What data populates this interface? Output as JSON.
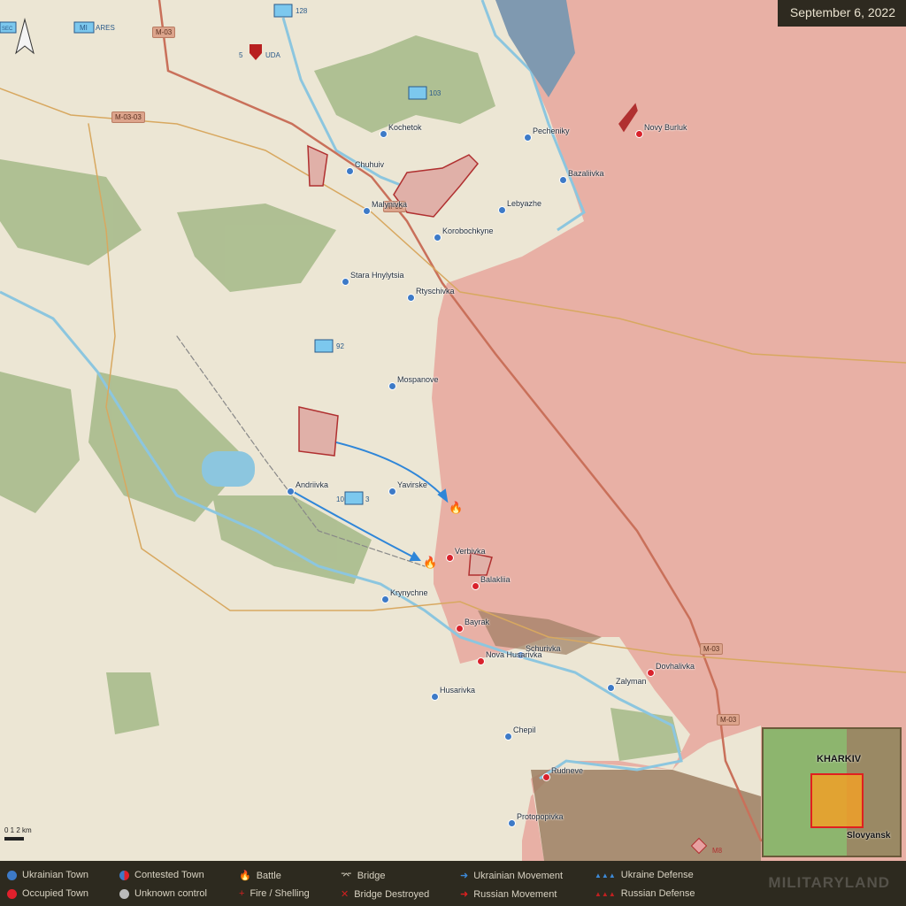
{
  "date": "September 6, 2022",
  "roads": [
    "M-03",
    "M-03",
    "M-03",
    "M-03",
    "M-03-03"
  ],
  "towns": [
    {
      "name": "Chuhuiv",
      "status": "ukrainian"
    },
    {
      "name": "Malynivka",
      "status": "ukrainian"
    },
    {
      "name": "Kochetok",
      "status": "ukrainian"
    },
    {
      "name": "Pecheniky",
      "status": "ukrainian"
    },
    {
      "name": "Bazaliivka",
      "status": "ukrainian"
    },
    {
      "name": "Lebyazhe",
      "status": "ukrainian"
    },
    {
      "name": "Korobochkyne",
      "status": "ukrainian"
    },
    {
      "name": "Stara Hnylytsia",
      "status": "ukrainian"
    },
    {
      "name": "Rtyschivka",
      "status": "ukrainian"
    },
    {
      "name": "Mospanove",
      "status": "ukrainian"
    },
    {
      "name": "Yavirske",
      "status": "ukrainian"
    },
    {
      "name": "Andriivka",
      "status": "ukrainian"
    },
    {
      "name": "Krynychne",
      "status": "ukrainian"
    },
    {
      "name": "Schurivka",
      "status": "ukrainian"
    },
    {
      "name": "Zalyman",
      "status": "ukrainian"
    },
    {
      "name": "Husarivka",
      "status": "ukrainian"
    },
    {
      "name": "Chepil",
      "status": "ukrainian"
    },
    {
      "name": "Protopopivka",
      "status": "ukrainian"
    },
    {
      "name": "Novy Burluk",
      "status": "occupied"
    },
    {
      "name": "Verbivka",
      "status": "occupied"
    },
    {
      "name": "Balakliia",
      "status": "occupied"
    },
    {
      "name": "Bayrak",
      "status": "occupied"
    },
    {
      "name": "Nova Husarivka",
      "status": "occupied"
    },
    {
      "name": "Dovhalivka",
      "status": "occupied"
    },
    {
      "name": "Rudneve",
      "status": "occupied"
    }
  ],
  "units": [
    "128",
    "5",
    "UDA",
    "103",
    "92",
    "10",
    "3",
    "MI",
    "SEC",
    "ARES",
    "M8"
  ],
  "scale": "0 1 2 km",
  "inset": {
    "city1": "KHARKIV",
    "city2": "Slovyansk"
  },
  "legend": [
    {
      "label": "Ukrainian Town",
      "icon": "blue-dot"
    },
    {
      "label": "Occupied Town",
      "icon": "red-dot"
    },
    {
      "label": "Contested Town",
      "icon": "half-dot"
    },
    {
      "label": "Unknown control",
      "icon": "grey-dot"
    },
    {
      "label": "Battle",
      "icon": "fire"
    },
    {
      "label": "Fire / Shelling",
      "icon": "cross"
    },
    {
      "label": "Bridge",
      "icon": "bridge"
    },
    {
      "label": "Bridge Destroyed",
      "icon": "bridge-destroyed"
    },
    {
      "label": "Ukrainian Movement",
      "icon": "blue-arrow"
    },
    {
      "label": "Russian Movement",
      "icon": "red-arrow"
    },
    {
      "label": "Ukraine Defense",
      "icon": "blue-teeth"
    },
    {
      "label": "Russian Defense",
      "icon": "red-teeth"
    }
  ],
  "brand": "MILITARYLAND",
  "colors": {
    "occupied": "#e8aaa0",
    "ukrainian": "#3d7ac7",
    "russian": "#d9222c",
    "land": "#ece6d4",
    "forest": "#a7b98a",
    "water": "#8cc6df"
  }
}
